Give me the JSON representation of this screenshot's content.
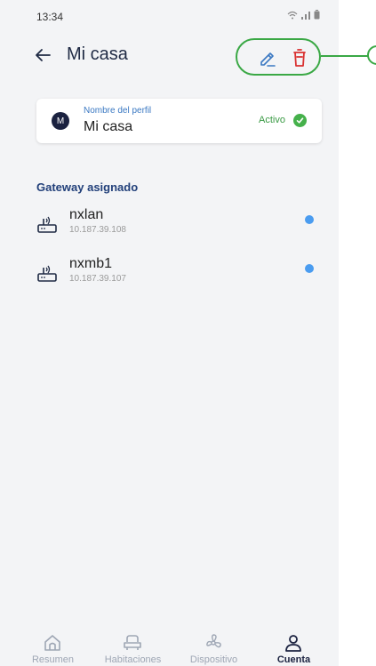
{
  "status_bar": {
    "time": "13:34"
  },
  "header": {
    "title": "Mi casa"
  },
  "profile": {
    "avatar_letter": "M",
    "label": "Nombre del perfil",
    "name": "Mi casa",
    "status": "Activo"
  },
  "gateways": {
    "section_title": "Gateway asignado",
    "items": [
      {
        "name": "nxlan",
        "ip": "10.187.39.108"
      },
      {
        "name": "nxmb1",
        "ip": "10.187.39.107"
      }
    ]
  },
  "bottom_nav": {
    "items": [
      {
        "label": "Resumen",
        "icon": "home-icon"
      },
      {
        "label": "Habitaciones",
        "icon": "sofa-icon"
      },
      {
        "label": "Dispositivo",
        "icon": "fan-icon"
      },
      {
        "label": "Cuenta",
        "icon": "user-icon"
      }
    ],
    "active": "Cuenta"
  },
  "colors": {
    "accent": "#1b2240",
    "highlight": "#3aa845",
    "delete": "#d93030",
    "edit": "#3a78c2",
    "online_dot": "#4a9cf0"
  }
}
